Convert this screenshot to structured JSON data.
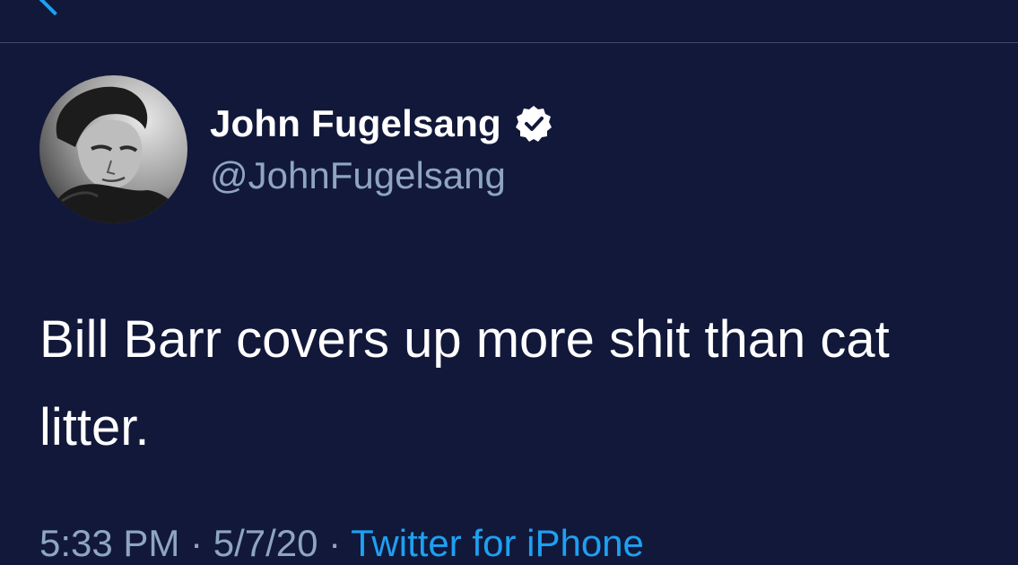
{
  "tweet": {
    "author": {
      "display_name": "John Fugelsang",
      "handle": "@JohnFugelsang",
      "verified": true
    },
    "text": "Bill Barr covers up more shit than cat litter.",
    "timestamp": "5:33 PM · 5/7/20 · ",
    "source": "Twitter for iPhone"
  },
  "colors": {
    "background": "#12183a",
    "accent": "#1da1f2",
    "secondary_text": "#8fa5c2"
  },
  "icons": {
    "back": "chevron-left-icon",
    "verified": "verified-badge-icon"
  }
}
